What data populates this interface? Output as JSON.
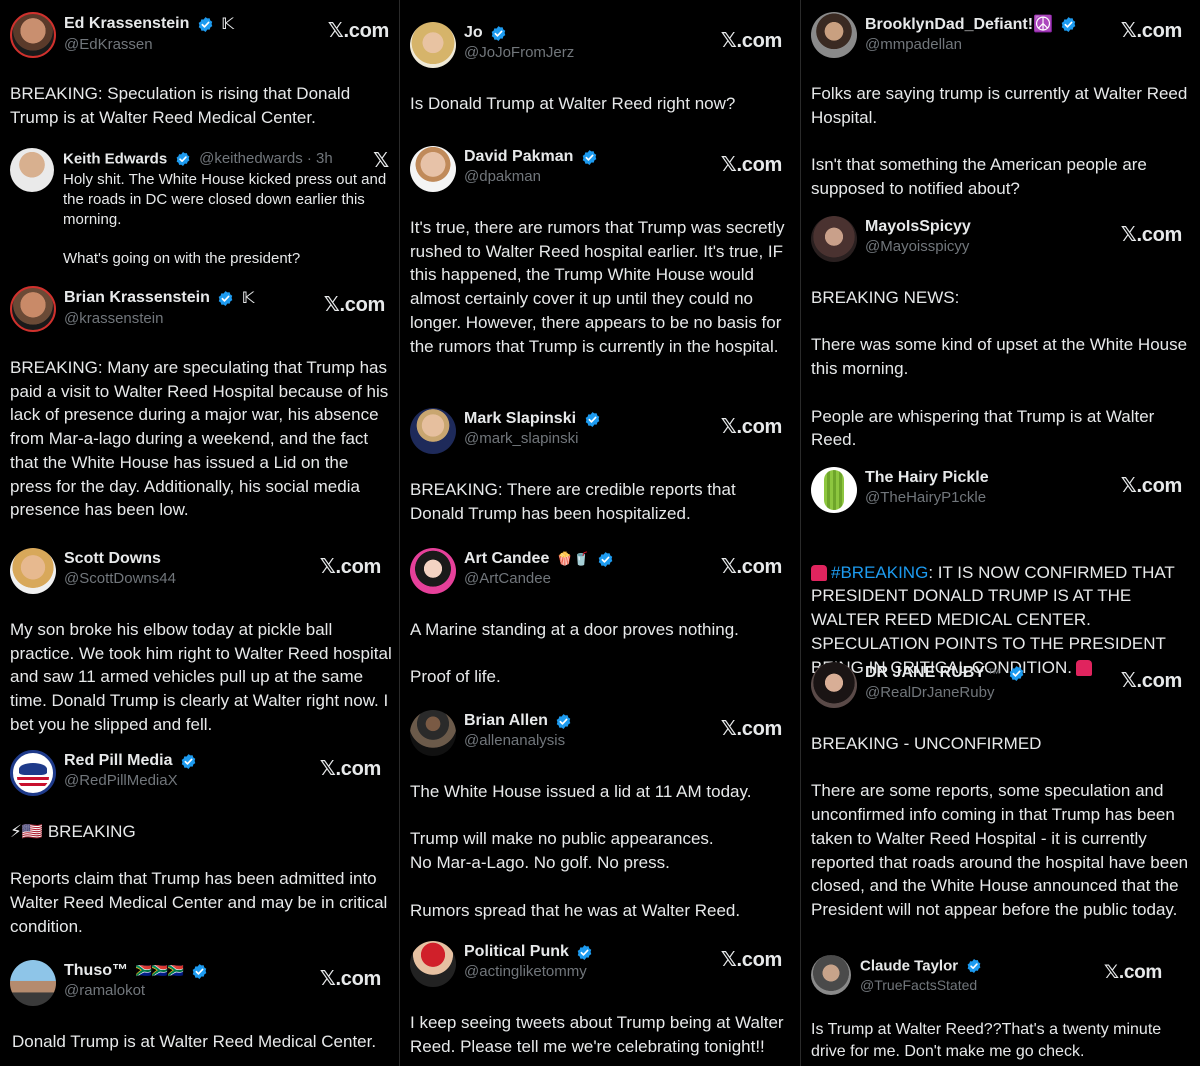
{
  "colors": {
    "background": "#000000",
    "text": "#e7e9ea",
    "muted": "#71767b",
    "verified": "#1d9bf0",
    "link": "#1d9bf0"
  },
  "brand_label": "𝕏.com",
  "col1": {
    "t1": {
      "name": "Ed Krassenstein",
      "handle": "@EdKrassen",
      "body": "BREAKING: Speculation is rising that Donald Trump is at Walter Reed Medical Center."
    },
    "q1": {
      "name": "Keith Edwards",
      "handle_time": "@keithedwards · 3h",
      "body": "Holy shit. The White House kicked press out and the roads in DC were closed down earlier this morning.\n\nWhat's going on with the president?"
    },
    "t2": {
      "name": "Brian Krassenstein",
      "handle": "@krassenstein",
      "body": "BREAKING: Many are speculating that Trump has paid a visit to Walter Reed Hospital because of his lack of presence during a major war, his absence from Mar-a-lago during a weekend, and the fact that the White House has issued a Lid on the press for the day. Additionally, his social media presence has been low."
    },
    "t3": {
      "name": "Scott Downs",
      "handle": "@ScottDowns44",
      "body": "My son broke his elbow today at pickle ball practice. We took him right to Walter Reed hospital and saw 11 armed vehicles pull up at the same time. Donald Trump is clearly at Walter right now. I bet you he slipped and fell."
    },
    "t4": {
      "name": "Red Pill Media",
      "handle": "@RedPillMediaX",
      "body": "⚡🇺🇸 BREAKING\n\nReports claim that Trump has been admitted into Walter Reed Medical Center and may be in critical condition."
    },
    "t5": {
      "name": "Thuso™",
      "flags": "🇿🇦🇿🇦🇿🇦",
      "handle": "@ramalokot",
      "body": "Donald Trump is at Walter Reed Medical Center."
    }
  },
  "col2": {
    "t1": {
      "name": "Jo",
      "handle": "@JoJoFromJerz",
      "body": "Is Donald Trump at Walter Reed right now?"
    },
    "t2": {
      "name": "David Pakman",
      "handle": "@dpakman",
      "body": "It's true, there are rumors that Trump was secretly rushed to Walter Reed hospital earlier. It's true, IF this happened, the Trump White House would almost certainly cover it up until they could no longer. However, there appears to be no basis for the rumors that Trump is currently in the hospital."
    },
    "t3": {
      "name": "Mark Slapinski",
      "handle": "@mark_slapinski",
      "body": "BREAKING: There are credible reports that Donald Trump has been hospitalized."
    },
    "t4": {
      "name": "Art Candee",
      "emoji": "🍿🥤",
      "handle": "@ArtCandee",
      "body": "A Marine standing at a door proves nothing.\n\nProof of life."
    },
    "t5": {
      "name": "Brian Allen",
      "handle": "@allenanalysis",
      "body": "The White House issued a lid at 11 AM today.\n\nTrump will make no public appearances.\nNo Mar-a-Lago. No golf. No press.\n\nRumors spread that he was at Walter Reed."
    },
    "t6": {
      "name": "Political Punk",
      "handle": "@actingliketommy",
      "body": "I keep seeing tweets about Trump being at Walter Reed. Please tell me we're celebrating tonight!!"
    }
  },
  "col3": {
    "t1": {
      "name": "BrooklynDad_Defiant!☮️",
      "handle": "@mmpadellan",
      "body": "Folks are saying trump is currently at Walter Reed Hospital.\n\nIsn't that something the American people are supposed to notified about?"
    },
    "t2": {
      "name": "MayoIsSpicyy",
      "handle": "@Mayoisspicyy",
      "body": "BREAKING NEWS:\n\nThere was some kind of upset at the White House this morning.\n\nPeople are whispering that Trump is at Walter Reed."
    },
    "t3": {
      "name": "The Hairy Pickle",
      "handle": "@TheHairyP1ckle",
      "hashtag": "#BREAKING",
      "body": ": IT IS NOW CONFIRMED THAT PRESIDENT DONALD TRUMP IS AT THE WALTER REED MEDICAL CENTER. SPECULATION POINTS TO THE PRESIDENT BEING IN CRITICAL CONDITION."
    },
    "t4": {
      "name": "DR JANE RUBY",
      "tm": "™",
      "handle": "@RealDrJaneRuby",
      "body": "BREAKING - UNCONFIRMED\n\nThere are some reports, some speculation and unconfirmed info coming in that Trump has been taken to Walter Reed Hospital - it is currently reported that roads around the hospital have been closed, and the White House announced that the President will not appear before the public today."
    },
    "t5": {
      "name": "Claude Taylor",
      "handle": "@TrueFactsStated",
      "body": "Is Trump at Walter Reed??That's a twenty minute drive for me. Don't make me go check."
    }
  }
}
